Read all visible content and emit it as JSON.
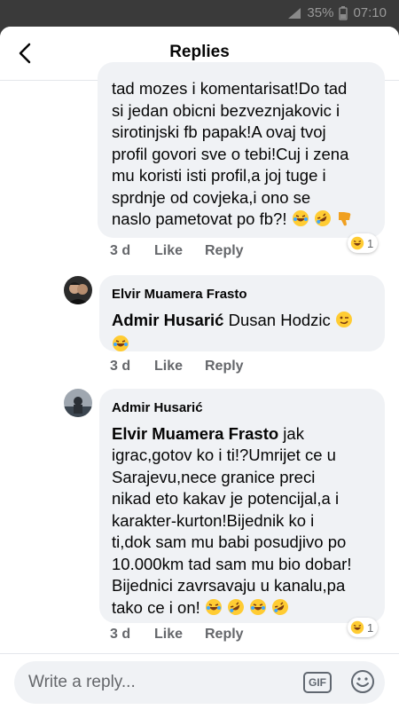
{
  "status_bar": {
    "battery": "35%",
    "time": "07:10"
  },
  "header": {
    "title": "Replies"
  },
  "comments": [
    {
      "lines": [
        "tad mozes i komentarisat!Do tad",
        "si jedan obicni bezveznjakovic i",
        "sirotinjski fb papak!A ovaj tvoj",
        "profil govori sve o tebi!Cuj i zena",
        "mu koristi isti profil,a joj tuge i",
        "sprdnje od covjeka,i ono se",
        "naslo pametovat po fb?!"
      ],
      "time": "3 d",
      "like": "Like",
      "reply": "Reply",
      "reaction_count": "1"
    },
    {
      "author": "Elvir Muamera Frasto",
      "mention": "Admir Husarić",
      "text": " Dusan Hodzic",
      "time": "3 d",
      "like": "Like",
      "reply": "Reply"
    },
    {
      "author": "Admir Husarić",
      "mention": "Elvir Muamera Frasto",
      "lines": [
        "jak",
        "igrac,gotov ko i ti!?Umrijet ce u",
        "Sarajevu,nece granice preci",
        "nikad eto kakav je potencijal,a i",
        "karakter-kurton!Bijednik ko i",
        "ti,dok sam mu babi posudjivo po",
        "10.000km tad sam mu bio dobar!",
        "Bijednici zavrsavaju u kanalu,pa",
        "tako ce i on!"
      ],
      "time": "3 d",
      "like": "Like",
      "reply": "Reply",
      "reaction_count": "1"
    }
  ],
  "composer": {
    "placeholder": "Write a reply...",
    "gif_label": "GIF"
  },
  "colors": {
    "bubble": "#f0f2f5",
    "meta": "#65676b",
    "emoji_yellow": "#ffcc33"
  }
}
